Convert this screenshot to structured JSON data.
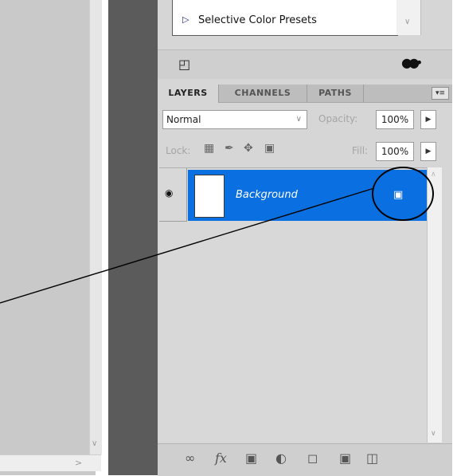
{
  "presets": {
    "item_label": "Selective Color Presets"
  },
  "tabs": [
    {
      "label": "LAYERS",
      "active": true
    },
    {
      "label": "CHANNELS",
      "active": false
    },
    {
      "label": "PATHS",
      "active": false
    }
  ],
  "blend_mode": "Normal",
  "opacity": {
    "label": "Opacity:",
    "value": "100%"
  },
  "lock": {
    "label": "Lock:"
  },
  "fill": {
    "label": "Fill:",
    "value": "100%"
  },
  "layers": [
    {
      "name": "Background",
      "visible": true,
      "locked": true,
      "selected": true
    }
  ],
  "colors": {
    "selection": "#0a6fe0",
    "panel": "#d6d6d6",
    "divider": "#5b5b5b"
  }
}
